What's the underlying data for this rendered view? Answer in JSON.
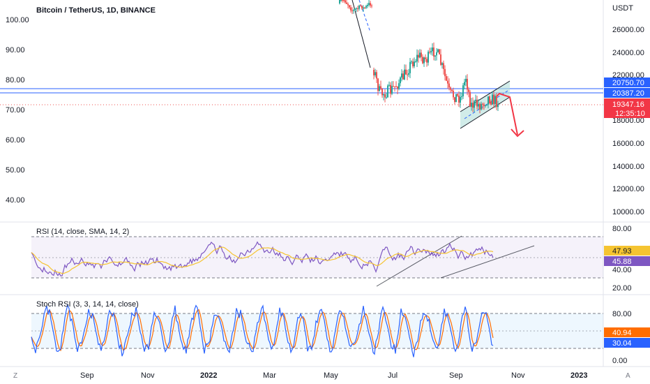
{
  "header": {
    "title": "Bitcoin / TetherUS, 1D, BINANCE"
  },
  "price_axis": {
    "unit": "USDT",
    "labels": [
      "26000.00",
      "24000.00",
      "22000.00",
      "18000.00",
      "16000.00",
      "14000.00",
      "12000.00",
      "10000.00"
    ]
  },
  "left_axis": {
    "labels": [
      "100.00",
      "90.00",
      "80.00",
      "70.00",
      "60.00",
      "50.00",
      "40.00"
    ]
  },
  "price_tags": {
    "upper_line": "20750.70",
    "lower_line": "20387.20",
    "last_price": "19347.16",
    "countdown": "12:35:10"
  },
  "rsi_pane": {
    "title": "RSI (14, close, SMA, 14, 2)",
    "axis_labels": [
      "80.00",
      "40.00",
      "20.00"
    ],
    "rsi_value": "45.88",
    "sma_value": "47.93"
  },
  "stoch_pane": {
    "title": "Stoch RSI (3, 3, 14, 14, close)",
    "axis_labels": [
      "80.00",
      "0.00"
    ],
    "k_value": "40.94",
    "d_value": "30.04"
  },
  "time_axis": {
    "labels": [
      "Sep",
      "Nov",
      "2022",
      "Mar",
      "May",
      "Jul",
      "Sep",
      "Nov",
      "2023"
    ]
  },
  "controls": {
    "left_corner": "Z",
    "right_corner": "A"
  },
  "colors": {
    "bull": "#26a69a",
    "bear": "#ef5350",
    "blue_line": "#2962ff",
    "rsi": "#7e57c2",
    "rsi_sma": "#f5c431",
    "stoch_k": "#2962ff",
    "stoch_d": "#ff6d00",
    "channel_fill": "#b2dfdb",
    "arrow": "#f23645"
  }
}
